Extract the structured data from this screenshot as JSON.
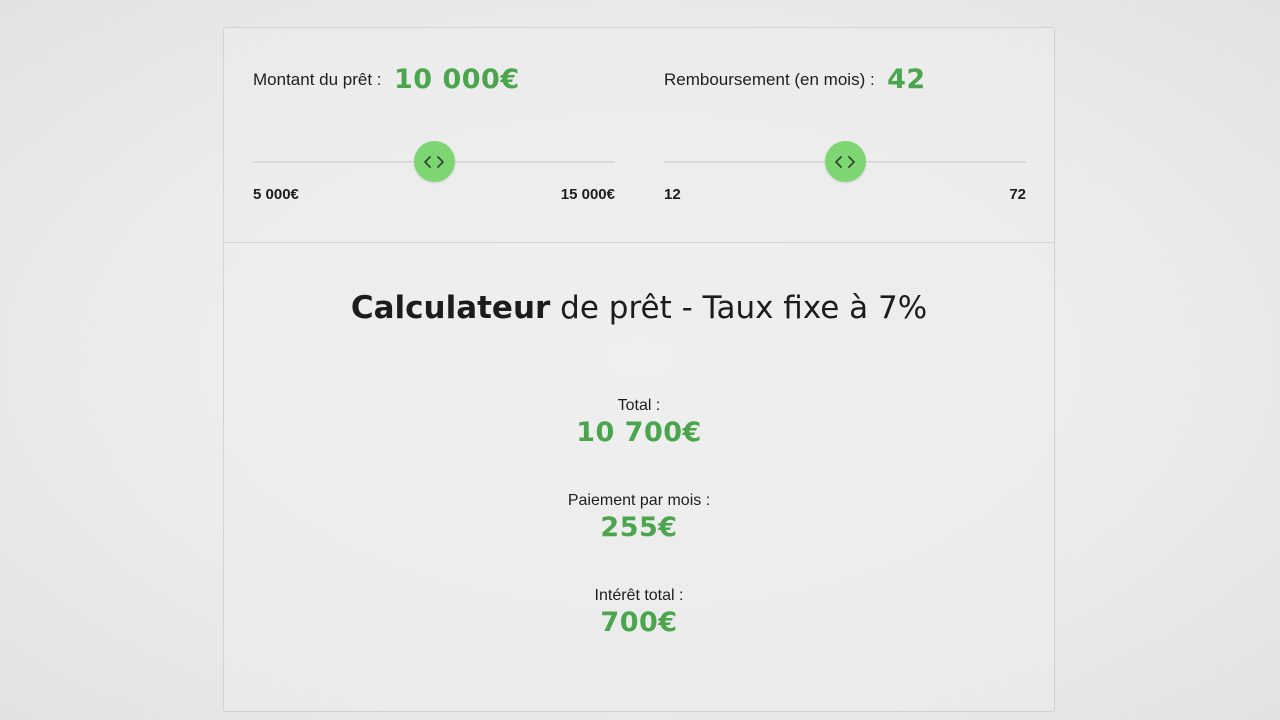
{
  "loan_amount": {
    "label": "Montant du prêt :",
    "value": "10 000€",
    "min_label": "5 000€",
    "max_label": "15 000€",
    "slider_position": 0.5
  },
  "repayment": {
    "label": "Remboursement (en mois) :",
    "value": "42",
    "min_label": "12",
    "max_label": "72",
    "slider_position": 0.5
  },
  "calculator": {
    "title_bold": "Calculateur",
    "title_rest": " de prêt - Taux fixe à 7%"
  },
  "results": {
    "total": {
      "label": "Total :",
      "value": "10 700€"
    },
    "monthly": {
      "label": "Paiement par mois :",
      "value": "255€"
    },
    "interest": {
      "label": "Intérêt total :",
      "value": "700€"
    }
  },
  "colors": {
    "accent": "#4aa54d",
    "thumb": "#7ed673"
  },
  "icons": {
    "slider_thumb": "chevrons-left-right-icon"
  }
}
